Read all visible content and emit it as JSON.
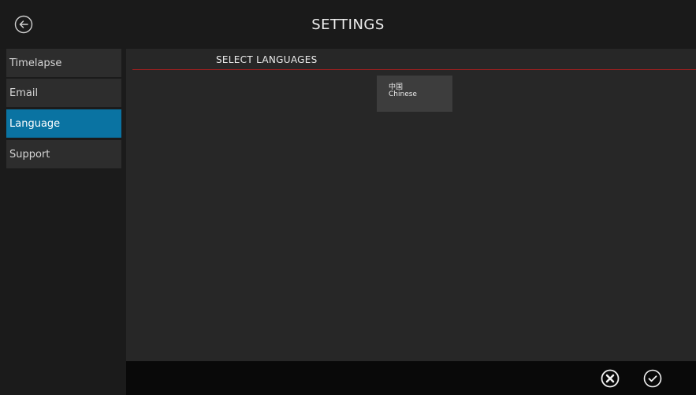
{
  "header": {
    "title": "SETTINGS",
    "back_icon": "back-arrow-circle-icon"
  },
  "sidebar": {
    "items": [
      {
        "label": "Timelapse",
        "active": false
      },
      {
        "label": "Email",
        "active": false
      },
      {
        "label": "Language",
        "active": true
      },
      {
        "label": "Support",
        "active": false
      }
    ]
  },
  "main": {
    "section_title": "SELECT LANGUAGES",
    "languages": [
      {
        "native": "中国",
        "english": "Chinese"
      }
    ]
  },
  "footer": {
    "cancel_icon": "cancel-circle-icon",
    "confirm_icon": "check-circle-icon"
  },
  "colors": {
    "accent": "#0a73a2",
    "divider": "#a41f1f",
    "background": "#1b1b1b",
    "panel": "#272727",
    "footer": "#090909"
  }
}
